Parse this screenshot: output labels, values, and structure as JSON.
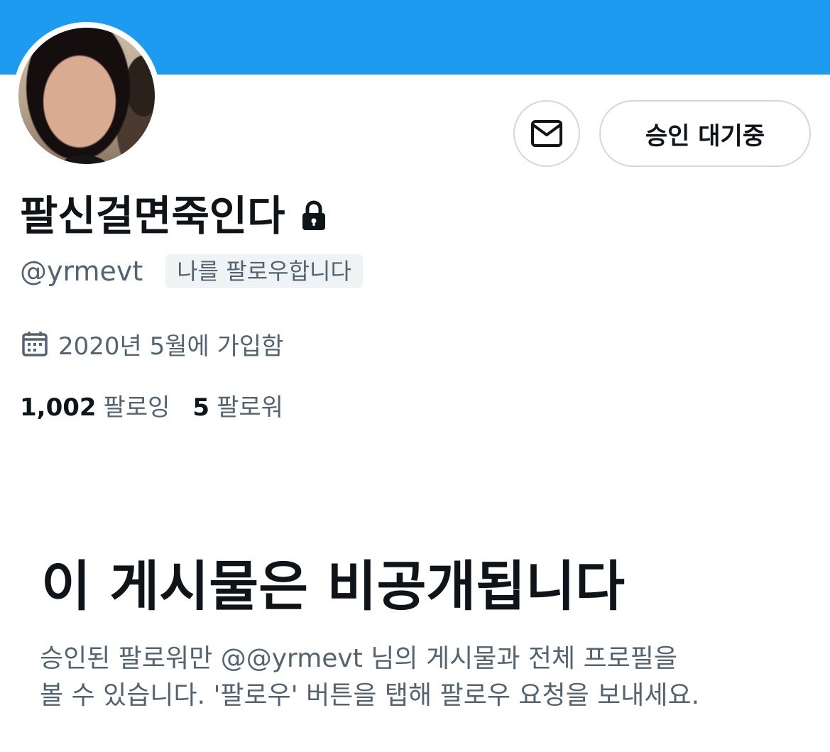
{
  "profile": {
    "display_name": "팔신걸면죽인다",
    "handle": "@yrmevt",
    "follows_you_badge": "나를 팔로우합니다",
    "joined": "2020년 5월에 가입함",
    "following_count": "1,002",
    "following_label": "팔로잉",
    "followers_count": "5",
    "followers_label": "팔로워"
  },
  "actions": {
    "message_icon": "mail-icon",
    "pending_label": "승인 대기중"
  },
  "icons": {
    "lock": "lock-icon",
    "calendar": "calendar-icon"
  },
  "private_notice": {
    "title": "이 게시물은 비공개됩니다",
    "description_line1": "승인된 팔로워만 @@yrmevt 님의 게시물과 전체 프로필을",
    "description_line2": "볼 수 있습니다. '팔로우' 버튼을 탭해 팔로우 요청을 보내세요."
  },
  "colors": {
    "banner": "#1d9bf0",
    "text_primary": "#0f1419",
    "text_secondary": "#536471",
    "border": "#cfd9de",
    "badge_bg": "#eff3f4"
  }
}
